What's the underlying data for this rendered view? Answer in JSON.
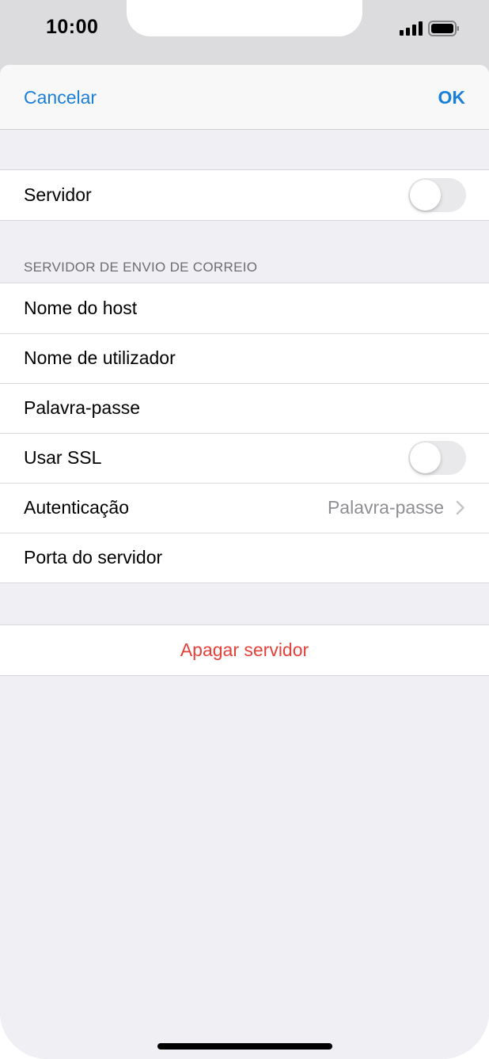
{
  "status_bar": {
    "time": "10:00",
    "signal_icon": "cellular-signal-icon",
    "battery_icon": "battery-icon"
  },
  "navbar": {
    "cancel_label": "Cancelar",
    "ok_label": "OK"
  },
  "server_group": {
    "server_label": "Servidor",
    "server_toggle_on": false
  },
  "outgoing_section": {
    "header": "SERVIDOR DE ENVIO DE CORREIO",
    "hostname_label": "Nome do host",
    "username_label": "Nome de utilizador",
    "password_label": "Palavra-passe",
    "ssl_label": "Usar SSL",
    "ssl_toggle_on": false,
    "auth_label": "Autenticação",
    "auth_value": "Palavra-passe",
    "port_label": "Porta do servidor"
  },
  "delete": {
    "label": "Apagar servidor"
  },
  "colors": {
    "accent": "#1a7fd8",
    "destructive": "#e5413a",
    "background": "#efeff4"
  }
}
